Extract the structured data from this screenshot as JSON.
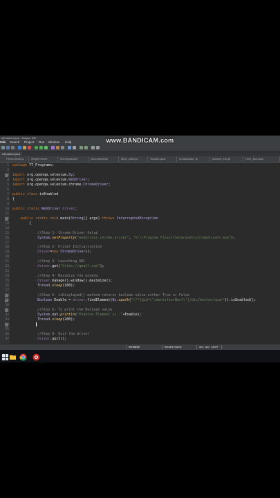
{
  "watermark": "www.BANDICAM.com",
  "window": {
    "title": "isEnabled.java - Eclipse IDE"
  },
  "menu": [
    "File",
    "Edit",
    "Search",
    "Project",
    "Run",
    "Window",
    "Help"
  ],
  "editor_tab": "isEnabled.java",
  "tabs": [
    "Hierarchical.ja",
    "Single Inherit",
    "Nonhyoliscent",
    "Nonoutputiast",
    "Multi_catch.ja",
    "Tocatch.java",
    "encapsulate_ts",
    "student_info.ja",
    "Html_Boo.java"
  ],
  "code_lines": [
    {
      "n": "1",
      "text": "package YT_Programs;"
    },
    {
      "n": "2",
      "text": ""
    },
    {
      "n": "3",
      "text": "import org.openqa.selenium.By;"
    },
    {
      "n": "4",
      "text": "import org.openqa.selenium.WebDriver;"
    },
    {
      "n": "5",
      "text": "import org.openqa.selenium.chrome.ChromeDriver;"
    },
    {
      "n": "6",
      "text": ""
    },
    {
      "n": "7",
      "text": "public class isEnabled"
    },
    {
      "n": "8",
      "text": "{"
    },
    {
      "n": "9",
      "text": ""
    },
    {
      "n": "10",
      "text": "public static WebDriver driver;"
    },
    {
      "n": "11",
      "text": ""
    },
    {
      "n": "12",
      "text": "    public static void main(String[] args) throws InterruptedException"
    },
    {
      "n": "13",
      "text": "        {"
    },
    {
      "n": "14",
      "text": ""
    },
    {
      "n": "15",
      "text": "            //Step 1- Chrome Driver Setup"
    },
    {
      "n": "16",
      "text": "            System.setProperty(\"webdriver.chrome.driver\", \"D:\\\\Program Files\\\\Selenium\\\\chromedriver.exe\");"
    },
    {
      "n": "17",
      "text": ""
    },
    {
      "n": "18",
      "text": "            //Step 2- Driver Initialization"
    },
    {
      "n": "19",
      "text": "            driver=new ChromeDriver();"
    },
    {
      "n": "20",
      "text": ""
    },
    {
      "n": "21",
      "text": "            //Step 3- Launching URL"
    },
    {
      "n": "22",
      "text": "            driver.get(\"https://gmail.com\");"
    },
    {
      "n": "23",
      "text": ""
    },
    {
      "n": "24",
      "text": "            //Step 4- Maximize the window"
    },
    {
      "n": "25",
      "text": "            driver.manage().window().maximize();"
    },
    {
      "n": "26",
      "text": "            Thread.sleep(100);"
    },
    {
      "n": "27",
      "text": ""
    },
    {
      "n": "28",
      "text": "            //Step 5- isDisplayed() method returns boolean value either True or False"
    },
    {
      "n": "29",
      "text": "            Boolean Enable = driver.findElement(By.xpath(\"//*[@id=\\\"identifierNext\\\"]/div/button/span\")).isEnabled();"
    },
    {
      "n": "30",
      "text": ""
    },
    {
      "n": "31",
      "text": "            //Step 6- To print the Boolean value"
    },
    {
      "n": "32",
      "text": "            System.out.println(\"Enabled Element is :\"+Enable);"
    },
    {
      "n": "33",
      "text": "            Thread.sleep(200);"
    },
    {
      "n": "34",
      "text": ""
    },
    {
      "n": "35",
      "text": ""
    },
    {
      "n": "36",
      "text": "            //Step 8- Quit the driver"
    },
    {
      "n": "37",
      "text": "            driver.quit();"
    }
  ],
  "status": {
    "mode": "Writable",
    "insert": "Smart Insert",
    "position": "34 : 13 : 1047"
  },
  "colors": {
    "editor_bg": "#2b2b2b",
    "keyword": "#cc7832",
    "type": "#b9a7e8",
    "string": "#6a8759",
    "comment": "#8c8c8c",
    "static_field": "#9876aa",
    "static_method": "#ffc66d",
    "plain": "#e6e6e6"
  },
  "taskbar_icons": [
    "windows-start-icon",
    "file-explorer-icon",
    "chrome-icon",
    "eclipse-icon",
    "recording-icon"
  ]
}
